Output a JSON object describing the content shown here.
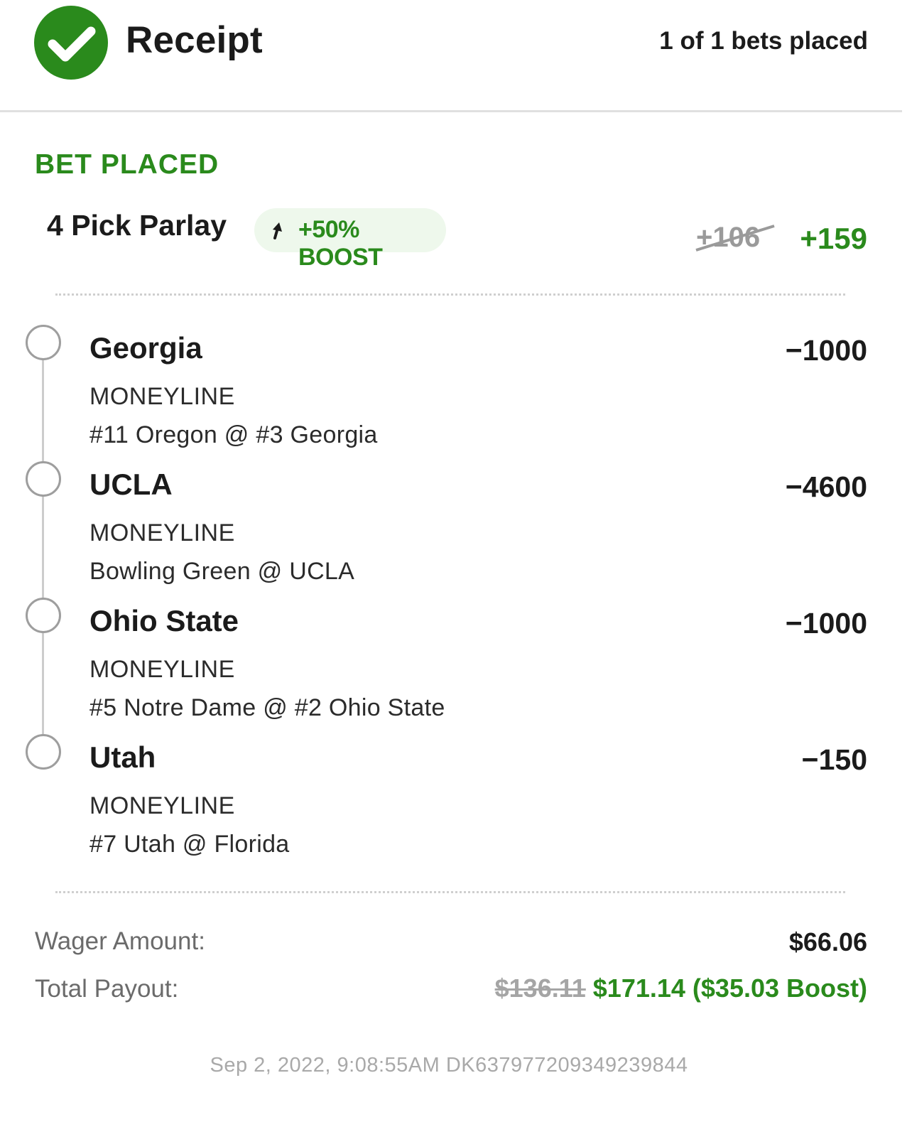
{
  "header": {
    "title": "Receipt",
    "bets_placed": "1 of 1 bets placed",
    "check_icon": "check-circle-icon"
  },
  "bet": {
    "status": "BET PLACED",
    "title": "4 Pick Parlay",
    "boost_label": "+50% BOOST",
    "old_odds": "+106",
    "new_odds": "+159"
  },
  "legs": [
    {
      "team": "Georgia",
      "odds": "−1000",
      "market": "MONEYLINE",
      "event": "#11 Oregon @ #3 Georgia"
    },
    {
      "team": "UCLA",
      "odds": "−4600",
      "market": "MONEYLINE",
      "event": "Bowling Green @ UCLA"
    },
    {
      "team": "Ohio State",
      "odds": "−1000",
      "market": "MONEYLINE",
      "event": "#5 Notre Dame @ #2 Ohio State"
    },
    {
      "team": "Utah",
      "odds": "−150",
      "market": "MONEYLINE",
      "event": "#7 Utah @ Florida"
    }
  ],
  "totals": {
    "wager_label": "Wager Amount:",
    "wager_value": "$66.06",
    "payout_label": "Total Payout:",
    "payout_old": "$136.11",
    "payout_new": "$171.14 ($35.03 Boost)"
  },
  "footer": "Sep 2, 2022, 9:08:55AM DK637977209349239844",
  "colors": {
    "accent_green": "#2a8a1c",
    "boost_bg": "#eef8ec",
    "muted": "#a9a9a9"
  }
}
